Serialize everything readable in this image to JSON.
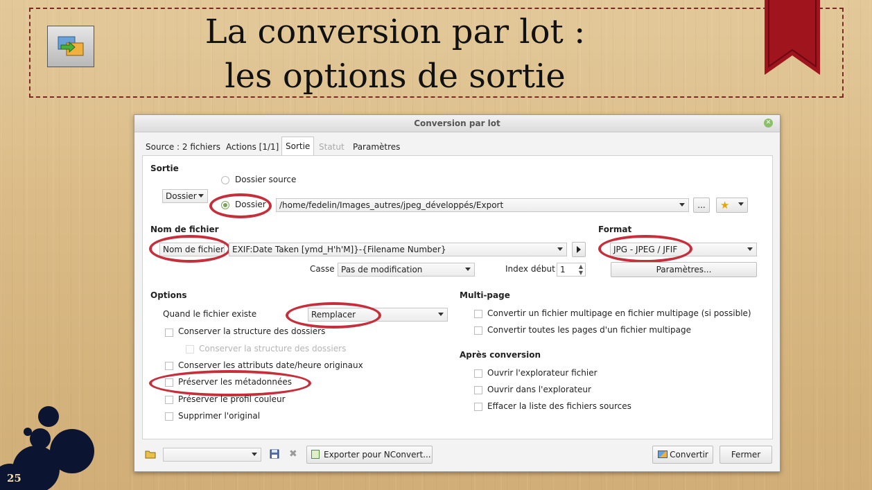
{
  "slide": {
    "title_line1": "La conversion par lot :",
    "title_line2": "les options de sortie",
    "page_number": "25"
  },
  "dialog": {
    "title": "Conversion par lot",
    "tabs": [
      {
        "label": "Source : 2 fichiers"
      },
      {
        "label": "Actions [1/1]"
      },
      {
        "label": "Sortie"
      },
      {
        "label": "Statut"
      },
      {
        "label": "Paramètres"
      }
    ],
    "active_tab": "Sortie",
    "sortie": {
      "section": "Sortie",
      "mode_select": "Dossier",
      "radio_source_label": "Dossier source",
      "radio_folder_label": "Dossier",
      "folder_path": "/home/fedelin/Images_autres/jpeg_développés/Export",
      "browse_label": "..."
    },
    "filename": {
      "section": "Nom de fichier",
      "mode_select": "Nom de fichier",
      "pattern": "EXIF:Date Taken [ymd_H'h'M]}-{Filename Number}",
      "case_label": "Casse",
      "case_value": "Pas de modification",
      "index_label": "Index début",
      "index_value": "1"
    },
    "format": {
      "section": "Format",
      "value": "JPG - JPEG / JFIF",
      "params_button": "Paramètres..."
    },
    "options": {
      "section": "Options",
      "exists_label": "Quand le fichier existe",
      "exists_value": "Remplacer",
      "items": [
        {
          "label": "Conserver la structure des dossiers",
          "enabled": true
        },
        {
          "label": "Conserver la structure des dossiers",
          "enabled": false
        },
        {
          "label": "Conserver les attributs date/heure originaux",
          "enabled": true
        },
        {
          "label": "Préserver les métadonnées",
          "enabled": true
        },
        {
          "label": "Préserver le profil couleur",
          "enabled": true
        },
        {
          "label": "Supprimer l'original",
          "enabled": true
        }
      ]
    },
    "multipage": {
      "section": "Multi-page",
      "items": [
        {
          "label": "Convertir un fichier multipage en fichier multipage (si possible)"
        },
        {
          "label": "Convertir toutes les pages d'un fichier multipage"
        }
      ]
    },
    "after": {
      "section": "Après conversion",
      "items": [
        {
          "label": "Ouvrir l'explorateur fichier"
        },
        {
          "label": "Ouvrir dans l'explorateur"
        },
        {
          "label": "Effacer la liste des fichiers sources"
        }
      ]
    },
    "bottom": {
      "export_button": "Exporter pour NConvert...",
      "convert_button": "Convertir",
      "close_button": "Fermer"
    }
  },
  "icons": [
    "batch-convert-icon",
    "bookmark-ribbon",
    "star-icon",
    "folder-icon",
    "save-icon",
    "delete-icon",
    "export-icon",
    "convert-icon",
    "play-icon"
  ],
  "colors": {
    "highlight_ring": "#c62f3a",
    "ribbon": "#a0141e",
    "radio_on": "#7aa35a",
    "title_frame": "#7a2a22"
  }
}
